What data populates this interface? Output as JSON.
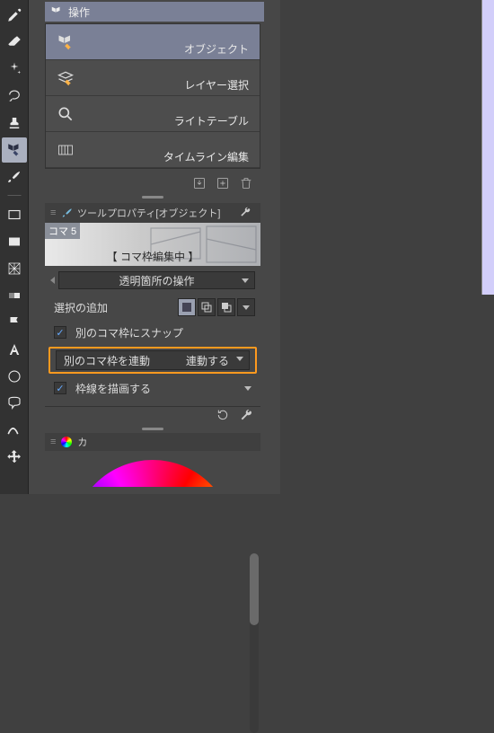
{
  "header": {
    "title": "操作"
  },
  "sub": {
    "items": [
      {
        "label": "オブジェクト"
      },
      {
        "label": "レイヤー選択"
      },
      {
        "label": "ライトテーブル"
      },
      {
        "label": "タイムライン編集"
      }
    ]
  },
  "propPanel": {
    "title": "ツールプロパティ[オブジェクト]"
  },
  "preview": {
    "tag": "コマ 5",
    "caption": "【 コマ枠編集中 】"
  },
  "props": {
    "transparent_op": "透明箇所の操作",
    "add_select": "選択の追加",
    "snap_other": "別のコマ枠にスナップ",
    "link_other_label": "別のコマ枠を連動",
    "link_other_value": "連動する",
    "draw_border": "枠線を描画する"
  },
  "colorTab": {
    "label": "カ"
  }
}
